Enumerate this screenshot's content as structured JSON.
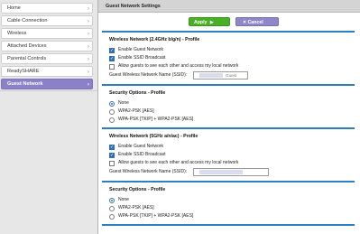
{
  "sidebar": {
    "items": [
      {
        "label": "Home"
      },
      {
        "label": "Cable Connection"
      },
      {
        "label": "Wireless"
      },
      {
        "label": "Attached Devices"
      },
      {
        "label": "Parental Controls"
      },
      {
        "label": "ReadySHARE"
      },
      {
        "label": "Guest Network",
        "active": true
      }
    ]
  },
  "header": {
    "title": "Guest Network Settings"
  },
  "toolbar": {
    "apply_label": "Apply",
    "cancel_label": "Cancel",
    "apply_color": "#48b023",
    "cancel_color": "#8e86c9"
  },
  "wireless24": {
    "title": "Wireless Network (2.4GHz b/g/n) - Profile",
    "enable_guest": {
      "label": "Enable Guest Network",
      "checked": true
    },
    "enable_ssid": {
      "label": "Enable SSID Broadcast",
      "checked": true
    },
    "allow_access": {
      "label": "Allow guests to see each other and access my local network",
      "checked": false
    },
    "ssid_label": "Guest Wireless Network Name (SSID):",
    "ssid_value": "Guest"
  },
  "security24": {
    "title": "Security Options - Profile",
    "options": [
      "None",
      "WPA2-PSK [AES]",
      "WPA-PSK [TKIP] + WPA2-PSK [AES]"
    ],
    "selected": "None"
  },
  "wireless5": {
    "title": "Wireless Network (5GHz a/n/ac) - Profile",
    "enable_guest": {
      "label": "Enable Guest Network",
      "checked": true
    },
    "enable_ssid": {
      "label": "Enable SSID Broadcast",
      "checked": true
    },
    "allow_access": {
      "label": "Allow guests to see each other and access my local network",
      "checked": false
    },
    "ssid_label": "Guest Wireless Network Name (SSID):"
  },
  "security5": {
    "title": "Security Options - Profile",
    "options": [
      "None",
      "WPA2-PSK [AES]",
      "WPA-PSK [TKIP] + WPA2-PSK [AES]"
    ],
    "selected": "None"
  },
  "colors": {
    "accent": "#2f7fc0",
    "active_nav": "#8a82c8",
    "sidebar_bg": "#e7e7e7"
  },
  "icons": {
    "nav_chevron": "chevron-right-icon",
    "apply": "arrow-right-icon",
    "cancel": "close-icon"
  }
}
